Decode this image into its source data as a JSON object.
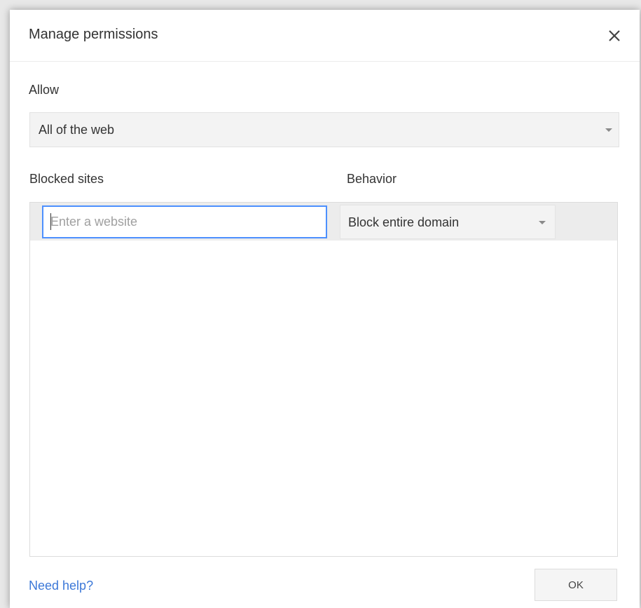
{
  "dialog": {
    "title": "Manage permissions"
  },
  "allow": {
    "label": "Allow",
    "selected": "All of the web"
  },
  "sites": {
    "blocked_label": "Blocked sites",
    "behavior_label": "Behavior",
    "input_placeholder": "Enter a website",
    "input_value": "",
    "behavior_selected": "Block entire domain"
  },
  "footer": {
    "help_link": "Need help?",
    "ok_label": "OK"
  },
  "icons": {
    "close": "close-icon",
    "dropdown": "caret-down-icon"
  },
  "colors": {
    "link": "#3c78d8",
    "focus_border": "#4d90fe"
  }
}
